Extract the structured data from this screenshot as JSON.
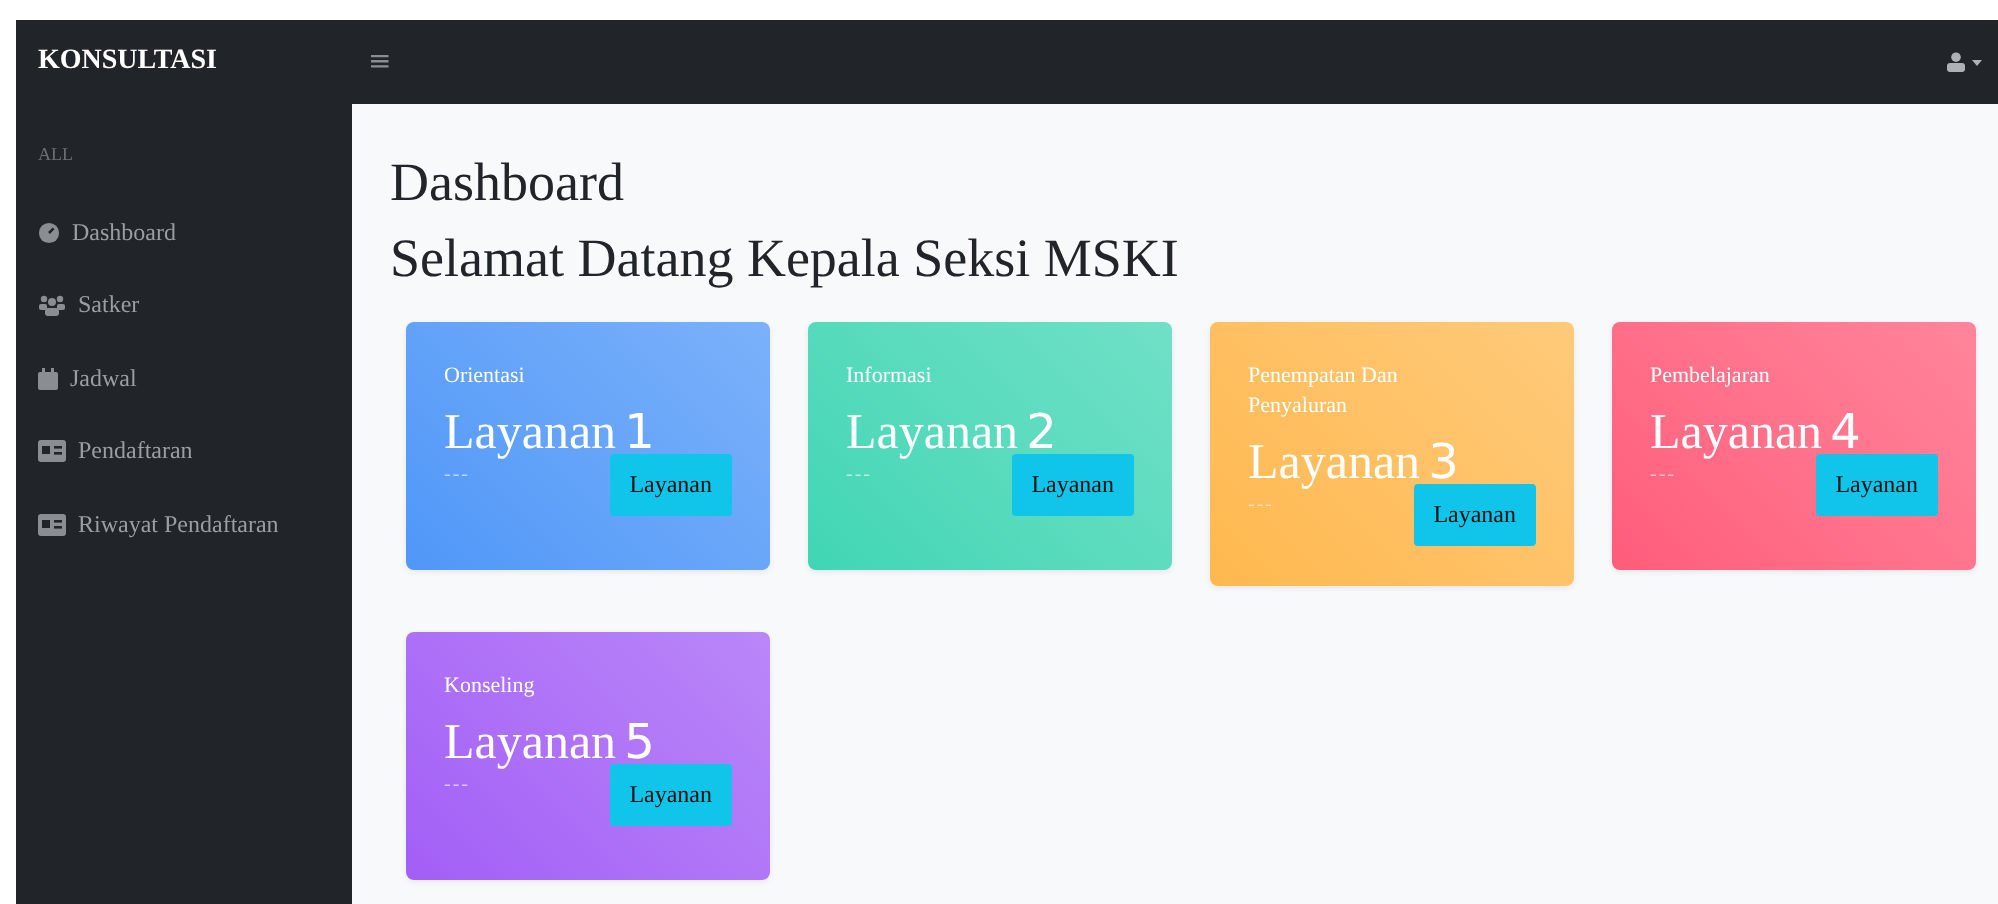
{
  "header": {
    "brand": "KONSULTASI",
    "menu_toggle": "≡"
  },
  "sidebar": {
    "section": "ALL",
    "items": [
      {
        "label": "Dashboard",
        "kind": "gauge",
        "selected": false
      },
      {
        "label": "Satker",
        "kind": "users",
        "selected": false
      },
      {
        "label": "Jadwal",
        "kind": "calendar",
        "selected": false
      },
      {
        "label": "Pendaftaran",
        "kind": "card",
        "selected": false
      },
      {
        "label": "Riwayat Pendaftaran",
        "kind": "card",
        "selected": false
      }
    ]
  },
  "page": {
    "title": "Dashboard",
    "greeting": "Selamat Datang Kepala Seksi MSKI"
  },
  "cards": [
    {
      "category": "Orientasi",
      "title": "Layanan",
      "number": "1",
      "note": "---",
      "button": "Layanan",
      "color": "#4f97f8"
    },
    {
      "category": "Informasi",
      "title": "Layanan",
      "number": "2",
      "note": "---",
      "button": "Layanan",
      "color": "#3fd6b4"
    },
    {
      "category": "Penempatan Dan Penyaluran",
      "title": "Layanan",
      "number": "3",
      "note": "---",
      "button": "Layanan",
      "color": "#ffb84d"
    },
    {
      "category": "Pembelajaran",
      "title": "Layanan",
      "number": "4",
      "note": "---",
      "button": "Layanan",
      "color": "#ff5c7a"
    },
    {
      "category": "Konseling",
      "title": "Layanan",
      "number": "5",
      "note": "---",
      "button": "Layanan",
      "color": "#a35ef6"
    }
  ]
}
